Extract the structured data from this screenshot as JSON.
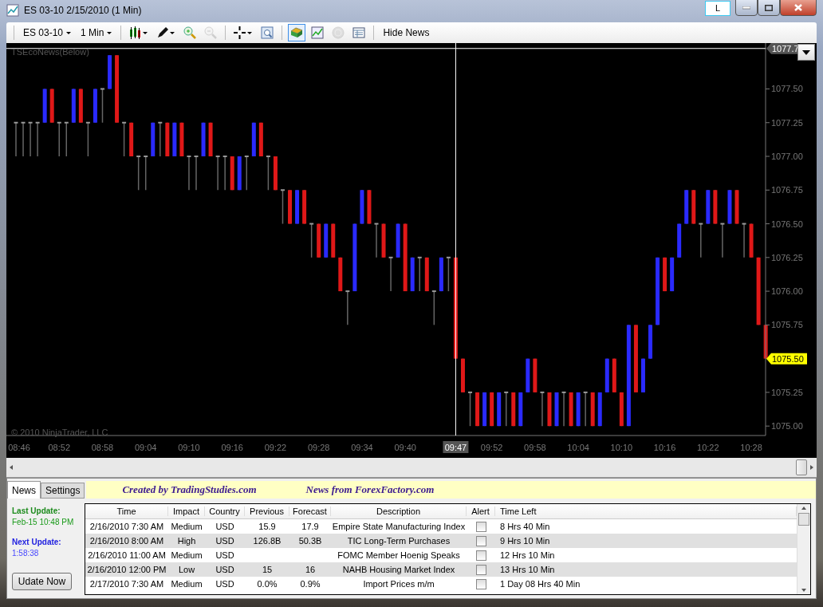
{
  "window": {
    "title": "ES 03-10  2/15/2010 (1 Min)",
    "badge": "L"
  },
  "toolbar": {
    "instrument": "ES 03-10",
    "interval": "1 Min",
    "tools": [
      {
        "kind": "candles",
        "selected": false,
        "disabled": false
      },
      {
        "kind": "pencil",
        "selected": false,
        "disabled": false
      },
      {
        "kind": "zoom-in",
        "selected": false,
        "disabled": false
      },
      {
        "kind": "zoom-out",
        "selected": false,
        "disabled": true
      },
      {
        "kind": "crosshair",
        "selected": false,
        "disabled": false
      },
      {
        "kind": "properties",
        "selected": false,
        "disabled": false
      },
      {
        "kind": "data",
        "selected": true,
        "disabled": false
      },
      {
        "kind": "chart",
        "selected": false,
        "disabled": false
      },
      {
        "kind": "coin",
        "selected": false,
        "disabled": true
      },
      {
        "kind": "table",
        "selected": false,
        "disabled": false
      }
    ],
    "hide_news": "Hide News"
  },
  "chart": {
    "indicator_label": "TSEcoNews(Below)",
    "copyright": "© 2010 NinjaTrader, LLC",
    "cursor_price": "1077.7",
    "cursor_time": "09:47",
    "last_price": "1075.50",
    "chart_data": {
      "type": "candlestick",
      "ylim": [
        1074.93,
        1077.84
      ],
      "categories": [
        "08:46",
        null,
        null,
        null,
        null,
        null,
        "08:52",
        null,
        null,
        null,
        null,
        null,
        "08:58",
        null,
        null,
        null,
        null,
        null,
        "09:04",
        null,
        null,
        null,
        null,
        null,
        "09:10",
        null,
        null,
        null,
        null,
        null,
        "09:16",
        null,
        null,
        null,
        null,
        null,
        "09:22",
        null,
        null,
        null,
        null,
        null,
        "09:28",
        null,
        null,
        null,
        null,
        null,
        "09:34",
        null,
        null,
        null,
        null,
        null,
        "09:40",
        null,
        null,
        null,
        null,
        null,
        null,
        null,
        null,
        null,
        null,
        null,
        "09:52",
        null,
        null,
        null,
        null,
        null,
        "09:58",
        null,
        null,
        null,
        null,
        null,
        "10:04",
        null,
        null,
        null,
        null,
        null,
        "10:10",
        null,
        null,
        null,
        null,
        null,
        "10:16",
        null,
        null,
        null,
        null,
        null,
        "10:22",
        null,
        null,
        null,
        null,
        null,
        "10:28",
        null,
        null
      ],
      "yticks": [
        {
          "value": 1075,
          "label": "1075.00"
        },
        {
          "value": 1075.25,
          "label": "1075.25"
        },
        {
          "value": 1075.75,
          "label": "1075.75"
        },
        {
          "value": 1076,
          "label": "1076.00"
        },
        {
          "value": 1076.25,
          "label": "1076.25"
        },
        {
          "value": 1076.5,
          "label": "1076.50"
        },
        {
          "value": 1076.75,
          "label": "1076.75"
        },
        {
          "value": 1077,
          "label": "1077.00"
        },
        {
          "value": 1077.25,
          "label": "1077.25"
        },
        {
          "value": 1077.5,
          "label": "1077.50"
        }
      ],
      "ohlc": [
        [
          1077.25,
          1077.25,
          1077,
          1077.25
        ],
        [
          1077.25,
          1077.25,
          1077,
          1077.25
        ],
        [
          1077.25,
          1077.25,
          1077,
          1077.25
        ],
        [
          1077.25,
          1077.25,
          1077,
          1077.25
        ],
        [
          1077.25,
          1077.5,
          1077.25,
          1077.5
        ],
        [
          1077.5,
          1077.5,
          1077.25,
          1077.25
        ],
        [
          1077.25,
          1077.25,
          1077,
          1077.25
        ],
        [
          1077.25,
          1077.25,
          1077,
          1077.25
        ],
        [
          1077.25,
          1077.5,
          1077.25,
          1077.5
        ],
        [
          1077.5,
          1077.5,
          1077.25,
          1077.25
        ],
        [
          1077.25,
          1077.25,
          1077,
          1077.25
        ],
        [
          1077.25,
          1077.5,
          1077.25,
          1077.5
        ],
        [
          1077.5,
          1077.5,
          1077.25,
          1077.5
        ],
        [
          1077.5,
          1077.75,
          1077.5,
          1077.75
        ],
        [
          1077.75,
          1077.75,
          1077.25,
          1077.25
        ],
        [
          1077.25,
          1077.25,
          1077,
          1077.25
        ],
        [
          1077.25,
          1077.25,
          1077,
          1077
        ],
        [
          1077,
          1077,
          1076.75,
          1077
        ],
        [
          1077,
          1077,
          1076.75,
          1077
        ],
        [
          1077,
          1077.25,
          1077,
          1077.25
        ],
        [
          1077.25,
          1077.25,
          1077,
          1077.25
        ],
        [
          1077.25,
          1077.25,
          1077,
          1077
        ],
        [
          1077,
          1077.25,
          1077,
          1077.25
        ],
        [
          1077.25,
          1077.25,
          1077,
          1077
        ],
        [
          1077,
          1077,
          1076.75,
          1077
        ],
        [
          1077,
          1077,
          1076.75,
          1077
        ],
        [
          1077,
          1077.25,
          1077,
          1077.25
        ],
        [
          1077.25,
          1077.25,
          1077,
          1077
        ],
        [
          1077,
          1077,
          1076.75,
          1077
        ],
        [
          1077,
          1077,
          1076.75,
          1077
        ],
        [
          1077,
          1077,
          1076.75,
          1076.75
        ],
        [
          1076.75,
          1077,
          1076.75,
          1077
        ],
        [
          1077,
          1077,
          1076.75,
          1077
        ],
        [
          1077,
          1077.25,
          1077,
          1077.25
        ],
        [
          1077.25,
          1077.25,
          1077,
          1077
        ],
        [
          1077,
          1077,
          1076.75,
          1077
        ],
        [
          1077,
          1077,
          1076.75,
          1076.75
        ],
        [
          1076.75,
          1076.75,
          1076.5,
          1076.75
        ],
        [
          1076.75,
          1076.75,
          1076.5,
          1076.5
        ],
        [
          1076.5,
          1076.75,
          1076.5,
          1076.75
        ],
        [
          1076.75,
          1076.75,
          1076.5,
          1076.5
        ],
        [
          1076.5,
          1076.5,
          1076.25,
          1076.5
        ],
        [
          1076.5,
          1076.5,
          1076.25,
          1076.25
        ],
        [
          1076.25,
          1076.5,
          1076.25,
          1076.5
        ],
        [
          1076.5,
          1076.5,
          1076.25,
          1076.25
        ],
        [
          1076.25,
          1076.25,
          1076,
          1076
        ],
        [
          1076,
          1076,
          1075.75,
          1076
        ],
        [
          1076,
          1076.5,
          1076,
          1076.5
        ],
        [
          1076.5,
          1076.75,
          1076.5,
          1076.75
        ],
        [
          1076.75,
          1076.75,
          1076.5,
          1076.5
        ],
        [
          1076.5,
          1076.5,
          1076.25,
          1076.5
        ],
        [
          1076.5,
          1076.5,
          1076.25,
          1076.25
        ],
        [
          1076.25,
          1076.25,
          1076,
          1076.25
        ],
        [
          1076.25,
          1076.5,
          1076.25,
          1076.5
        ],
        [
          1076.5,
          1076.5,
          1076,
          1076
        ],
        [
          1076,
          1076.25,
          1076,
          1076.25
        ],
        [
          1076.25,
          1076.25,
          1076,
          1076.25
        ],
        [
          1076.25,
          1076.25,
          1076,
          1076
        ],
        [
          1076,
          1076,
          1075.75,
          1076
        ],
        [
          1076,
          1076.25,
          1076,
          1076.25
        ],
        [
          1076.25,
          1076.25,
          1076,
          1076.25
        ],
        [
          1076.25,
          1076.25,
          1075.5,
          1075.5
        ],
        [
          1075.5,
          1075.5,
          1075.25,
          1075.25
        ],
        [
          1075.25,
          1075.25,
          1075,
          1075.25
        ],
        [
          1075.25,
          1075.25,
          1075,
          1075
        ],
        [
          1075,
          1075.25,
          1075,
          1075.25
        ],
        [
          1075.25,
          1075.25,
          1075,
          1075
        ],
        [
          1075,
          1075.25,
          1075,
          1075.25
        ],
        [
          1075.25,
          1075.25,
          1075,
          1075.25
        ],
        [
          1075.25,
          1075.25,
          1075,
          1075
        ],
        [
          1075,
          1075.25,
          1075,
          1075.25
        ],
        [
          1075.25,
          1075.5,
          1075.25,
          1075.5
        ],
        [
          1075.5,
          1075.5,
          1075.25,
          1075.25
        ],
        [
          1075.25,
          1075.25,
          1075,
          1075.25
        ],
        [
          1075.25,
          1075.25,
          1075,
          1075
        ],
        [
          1075,
          1075.25,
          1075,
          1075.25
        ],
        [
          1075.25,
          1075.25,
          1075,
          1075.25
        ],
        [
          1075.25,
          1075.25,
          1075,
          1075
        ],
        [
          1075,
          1075.25,
          1075,
          1075.25
        ],
        [
          1075.25,
          1075.25,
          1075,
          1075.25
        ],
        [
          1075.25,
          1075.25,
          1075,
          1075
        ],
        [
          1075,
          1075.25,
          1075,
          1075.25
        ],
        [
          1075.25,
          1075.5,
          1075.25,
          1075.5
        ],
        [
          1075.5,
          1075.5,
          1075.25,
          1075.25
        ],
        [
          1075.25,
          1075.25,
          1075,
          1075
        ],
        [
          1075,
          1075.75,
          1075,
          1075.75
        ],
        [
          1075.75,
          1075.75,
          1075.25,
          1075.25
        ],
        [
          1075.25,
          1075.5,
          1075.25,
          1075.5
        ],
        [
          1075.5,
          1075.75,
          1075.5,
          1075.75
        ],
        [
          1075.75,
          1076.25,
          1075.75,
          1076.25
        ],
        [
          1076.25,
          1076.25,
          1076,
          1076
        ],
        [
          1076,
          1076.25,
          1076,
          1076.25
        ],
        [
          1076.25,
          1076.5,
          1076.25,
          1076.5
        ],
        [
          1076.5,
          1076.75,
          1076.5,
          1076.75
        ],
        [
          1076.75,
          1076.75,
          1076.5,
          1076.5
        ],
        [
          1076.5,
          1076.5,
          1076.25,
          1076.5
        ],
        [
          1076.5,
          1076.75,
          1076.5,
          1076.75
        ],
        [
          1076.75,
          1076.75,
          1076.5,
          1076.5
        ],
        [
          1076.5,
          1076.5,
          1076.25,
          1076.5
        ],
        [
          1076.5,
          1076.75,
          1076.5,
          1076.75
        ],
        [
          1076.75,
          1076.75,
          1076.5,
          1076.5
        ],
        [
          1076.5,
          1076.5,
          1076.25,
          1076.5
        ],
        [
          1076.5,
          1076.5,
          1076.25,
          1076.25
        ],
        [
          1076.25,
          1076.25,
          1075.75,
          1075.75
        ],
        [
          1075.75,
          1075.75,
          1075.5,
          1075.5
        ]
      ]
    }
  },
  "news": {
    "tabs": [
      {
        "label": "News",
        "selected": true
      },
      {
        "label": "Settings",
        "selected": false
      }
    ],
    "banner": [
      "Created by TradingStudies.com",
      "News from ForexFactory.com"
    ],
    "last_update_label": "Last Update:",
    "last_update": "Feb-15 10:48 PM",
    "next_update_label": "Next Update:",
    "next_update": "1:58:38",
    "update_button": "Udate Now",
    "columns": [
      "Time",
      "Impact",
      "Country",
      "Previous",
      "Forecast",
      "Description",
      "Alert",
      "Time Left"
    ],
    "rows": [
      {
        "time": "2/16/2010 7:30 AM",
        "impact": "Medium",
        "country": "USD",
        "previous": "15.9",
        "forecast": "17.9",
        "description": "Empire State Manufacturing Index",
        "alert": false,
        "time_left": "8 Hrs 40 Min"
      },
      {
        "time": "2/16/2010 8:00 AM",
        "impact": "High",
        "country": "USD",
        "previous": "126.8B",
        "forecast": "50.3B",
        "description": "TIC Long-Term Purchases",
        "alert": false,
        "time_left": "9 Hrs 10 Min"
      },
      {
        "time": "2/16/2010 11:00 AM",
        "impact": "Medium",
        "country": "USD",
        "description": "FOMC Member Hoenig Speaks",
        "alert": false,
        "time_left": "12 Hrs 10 Min"
      },
      {
        "time": "2/16/2010 12:00 PM",
        "impact": "Low",
        "country": "USD",
        "previous": "15",
        "forecast": "16",
        "description": "NAHB Housing Market Index",
        "alert": false,
        "time_left": "13 Hrs 10 Min"
      },
      {
        "time": "2/17/2010 7:30 AM",
        "impact": "Medium",
        "country": "USD",
        "previous": "0.0%",
        "forecast": "0.9%",
        "description": "Import Prices m/m",
        "alert": false,
        "time_left": "1 Day 08 Hrs 40 Min"
      }
    ]
  }
}
